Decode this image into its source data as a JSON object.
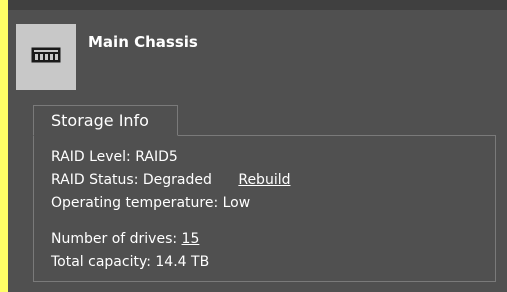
{
  "chassis": {
    "title": "Main Chassis",
    "icon": "server-chassis-icon"
  },
  "storage": {
    "tab_label": "Storage Info",
    "raid_level": "RAID Level: RAID5",
    "raid_status": "RAID Status: Degraded",
    "rebuild_label": "Rebuild",
    "temperature": "Operating temperature: Low",
    "drives_label": "Number of drives: ",
    "drives_count": "15",
    "capacity": "Total capacity: 14.4 TB"
  },
  "colors": {
    "background": "#ffff66",
    "panel": "#505050",
    "tile": "#c8c8c8",
    "text": "#ffffff"
  }
}
